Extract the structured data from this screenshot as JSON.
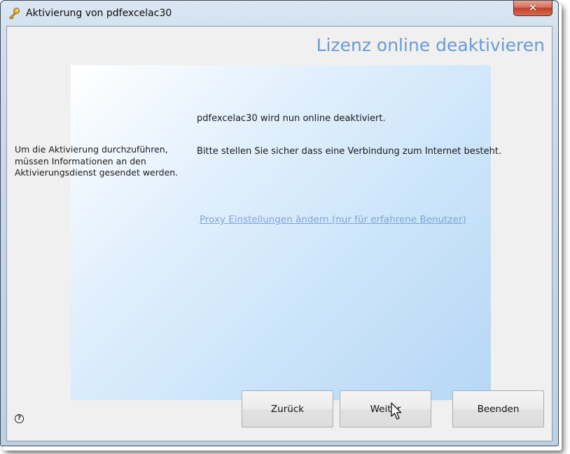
{
  "window": {
    "title": "Aktivierung von pdfexcelac30",
    "close_label": "✕",
    "icon": "key-icon"
  },
  "page": {
    "heading": "Lizenz online deaktivieren",
    "heading_color": "#6a9ad6"
  },
  "side_info": {
    "text": "Um die Aktivierung durchzuführen, müssen Informationen an den Aktivierungsdienst gesendet werden."
  },
  "messages": {
    "line1": "pdfexcelac30 wird nun online deaktiviert.",
    "line2": "Bitte stellen Sie sicher dass eine Verbindung zum Internet besteht."
  },
  "proxy_link": {
    "label": "Proxy Einstellungen ändern (nur für erfahrene Benutzer)",
    "color": "#7ea5d3"
  },
  "help": {
    "icon": "help-icon",
    "glyph": "?"
  },
  "buttons": {
    "back": "Zurück",
    "next": "Weiter",
    "quit": "Beenden"
  }
}
